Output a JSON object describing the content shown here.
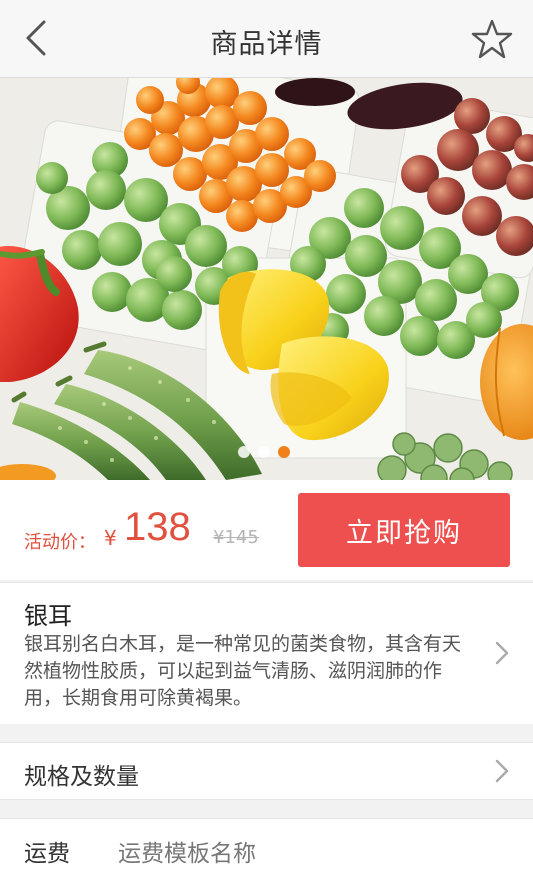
{
  "header": {
    "title": "商品详情",
    "back_icon": "chevron-left-icon",
    "favorite_icon": "star-outline-icon"
  },
  "carousel": {
    "image": "vegetables-photo",
    "total_slides": 3,
    "active_slide": 3
  },
  "price": {
    "label": "活动价：",
    "currency": "¥",
    "value": "138",
    "original": "¥145"
  },
  "buy_button": {
    "label": "立即抢购"
  },
  "description": {
    "title": "银耳",
    "text": "银耳别名白木耳，是一种常见的菌类食物，其含有天然植物性胶质，可以起到益气清肠、滋阴润肺的作用，长期食用可除黄褐果。"
  },
  "spec_row": {
    "label": "规格及数量"
  },
  "shipping_row": {
    "label": "运费",
    "value": "运费模板名称"
  },
  "colors": {
    "accent": "#ee4f4f",
    "price": "#e0513f",
    "active_dot": "#f28019"
  }
}
